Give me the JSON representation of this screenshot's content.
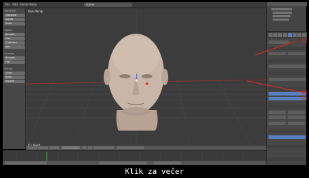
{
  "topbar": {
    "items": [
      "File",
      "Add",
      "Render",
      "Help"
    ],
    "scene": "Scene"
  },
  "viewport": {
    "label": "User Persp",
    "object_label": "(1) Head"
  },
  "toolshelf": {
    "sections": [
      {
        "header": "Transform",
        "buttons": [
          "Translate",
          "Rotate",
          "Scale"
        ]
      },
      {
        "header": "Object",
        "buttons": [
          "Smooth",
          "Flat",
          "Duplicate",
          "Join"
        ]
      },
      {
        "header": "Shading",
        "buttons": [
          "Smooth",
          "Flat"
        ]
      },
      {
        "header": "History",
        "buttons": [
          "Undo",
          "Redo",
          "Repeat"
        ]
      }
    ]
  },
  "caption": "Klik za večer",
  "colors": {
    "accent_red": "#d42b2b",
    "field_blue": "#5680c2"
  }
}
